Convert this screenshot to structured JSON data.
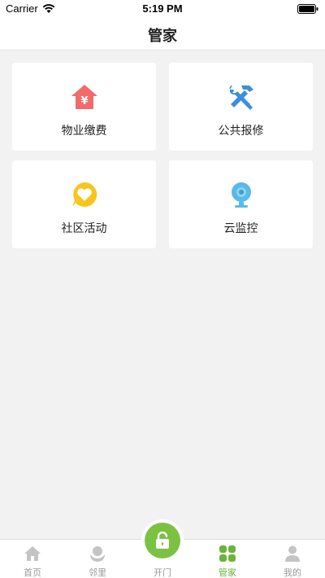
{
  "status_bar": {
    "carrier": "Carrier",
    "time": "5:19 PM"
  },
  "header": {
    "title": "管家"
  },
  "cards": [
    {
      "label": "物业缴费",
      "icon": "payment-house-icon",
      "color": "#f36a6a"
    },
    {
      "label": "公共报修",
      "icon": "repair-tools-icon",
      "color": "#3b8fd9"
    },
    {
      "label": "社区活动",
      "icon": "activity-heart-icon",
      "color": "#f7c51d"
    },
    {
      "label": "云监控",
      "icon": "camera-icon",
      "color": "#5ab9e8"
    }
  ],
  "tabs": [
    {
      "label": "首页",
      "icon": "home-icon"
    },
    {
      "label": "邻里",
      "icon": "neighbor-icon"
    },
    {
      "label": "开门",
      "icon": "unlock-icon"
    },
    {
      "label": "管家",
      "icon": "grid-icon",
      "active": true
    },
    {
      "label": "我的",
      "icon": "person-icon"
    }
  ],
  "colors": {
    "accent": "#6ab43b",
    "inactive": "#999999",
    "background": "#f2f2f2"
  }
}
